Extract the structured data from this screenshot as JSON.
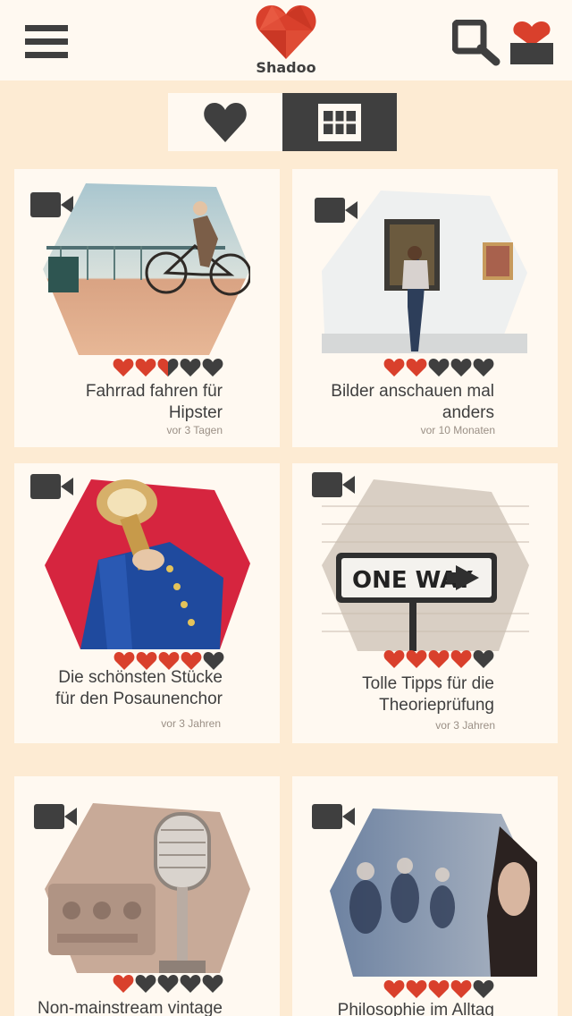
{
  "app": {
    "name": "Shadoo",
    "brand_color": "#d9402c",
    "dark_color": "#3f3f3f",
    "background": "#fdebd3"
  },
  "header": {
    "menu_icon": "hamburger-icon",
    "search_icon": "search-icon",
    "profile_icon": "profile-icon"
  },
  "view_toggle": {
    "options": [
      {
        "icon": "heart-icon",
        "active": false
      },
      {
        "icon": "grid-icon",
        "active": true
      }
    ]
  },
  "cards": [
    {
      "title": "Fahrrad fahren für\nHipster",
      "age": "vor 3 Tagen",
      "rating": 2.5,
      "icon": "video-camera-icon"
    },
    {
      "title": "Bilder anschauen mal\nanders",
      "age": "vor 10 Monaten",
      "rating": 2,
      "icon": "video-camera-icon"
    },
    {
      "title": "Die schönsten Stücke\nfür den Posaunenchor",
      "age": "vor 3 Jahren",
      "rating": 4,
      "icon": "video-camera-icon"
    },
    {
      "title": "Tolle Tipps für die\nTheorieprüfung",
      "age": "vor 3 Jahren",
      "rating": 4,
      "icon": "video-camera-icon"
    },
    {
      "title": "Non-mainstream vintage",
      "age": "",
      "rating": 1,
      "icon": "video-camera-icon"
    },
    {
      "title": "Philosophie im Alltag",
      "age": "",
      "rating": 4,
      "icon": "video-camera-icon"
    }
  ]
}
